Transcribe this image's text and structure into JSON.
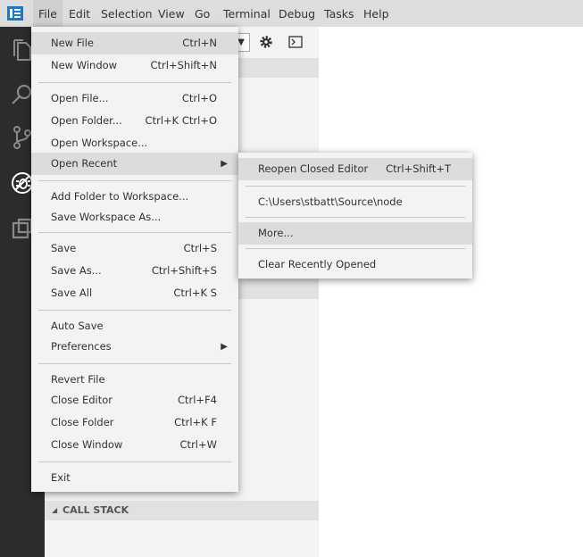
{
  "menubar": {
    "items": [
      {
        "label": "File"
      },
      {
        "label": "Edit"
      },
      {
        "label": "Selection"
      },
      {
        "label": "View"
      },
      {
        "label": "Go"
      },
      {
        "label": "Terminal"
      },
      {
        "label": "Debug"
      },
      {
        "label": "Tasks"
      },
      {
        "label": "Help"
      }
    ]
  },
  "file_menu": {
    "items": [
      {
        "label": "New File",
        "shortcut": "Ctrl+N"
      },
      {
        "label": "New Window",
        "shortcut": "Ctrl+Shift+N"
      },
      {
        "label": "Open File...",
        "shortcut": "Ctrl+O"
      },
      {
        "label": "Open Folder...",
        "shortcut": "Ctrl+K Ctrl+O"
      },
      {
        "label": "Open Workspace...",
        "shortcut": ""
      },
      {
        "label": "Open Recent",
        "shortcut": ""
      },
      {
        "label": "Add Folder to Workspace...",
        "shortcut": ""
      },
      {
        "label": "Save Workspace As...",
        "shortcut": ""
      },
      {
        "label": "Save",
        "shortcut": "Ctrl+S"
      },
      {
        "label": "Save As...",
        "shortcut": "Ctrl+Shift+S"
      },
      {
        "label": "Save All",
        "shortcut": "Ctrl+K S"
      },
      {
        "label": "Auto Save",
        "shortcut": ""
      },
      {
        "label": "Preferences",
        "shortcut": ""
      },
      {
        "label": "Revert File",
        "shortcut": ""
      },
      {
        "label": "Close Editor",
        "shortcut": "Ctrl+F4"
      },
      {
        "label": "Close Folder",
        "shortcut": "Ctrl+K F"
      },
      {
        "label": "Close Window",
        "shortcut": "Ctrl+W"
      },
      {
        "label": "Exit",
        "shortcut": ""
      }
    ]
  },
  "recent_menu": {
    "items": [
      {
        "label": "Reopen Closed Editor",
        "shortcut": "Ctrl+Shift+T"
      },
      {
        "label": "C:\\Users\\stbatt\\Source\\node",
        "shortcut": ""
      },
      {
        "label": "More...",
        "shortcut": ""
      },
      {
        "label": "Clear Recently Opened",
        "shortcut": ""
      }
    ]
  },
  "sidebar": {
    "call_stack_label": "CALL STACK"
  },
  "icons": {
    "submenu_arrow": "▶",
    "collapse_arrow": "◢",
    "dropdown_arrow": "▼"
  }
}
